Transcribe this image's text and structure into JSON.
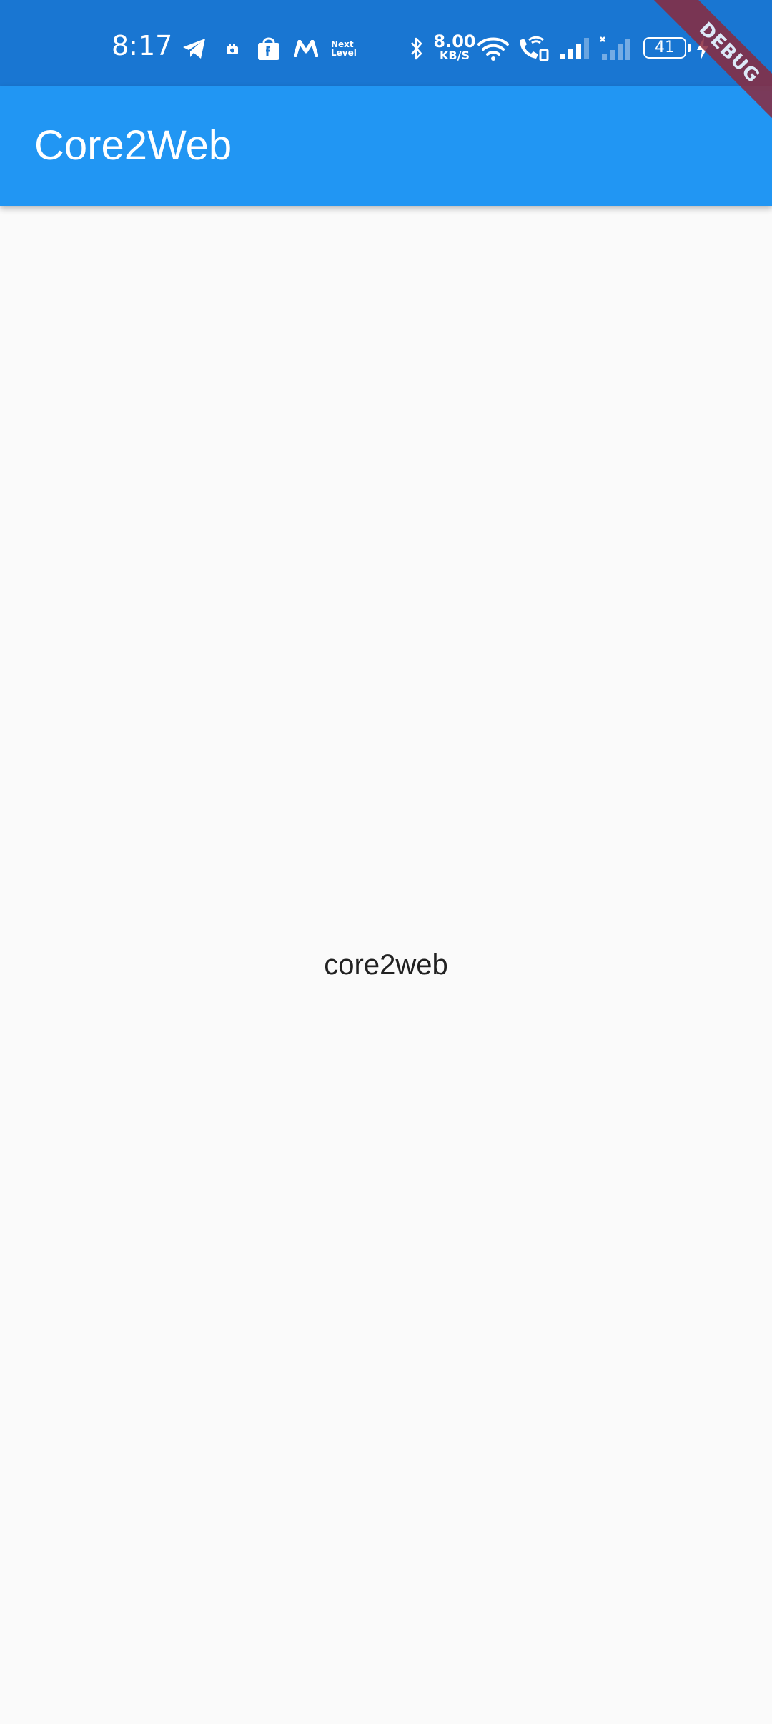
{
  "status_bar": {
    "time": "8:17",
    "notification_icons": [
      "telegram-icon",
      "camera-recorder-icon",
      "shopping-bag-icon",
      "myntra-icon"
    ],
    "next_level_text": "Next\nLevel",
    "network_speed_value": "8.00",
    "network_speed_unit": "KB/S",
    "system_icons": [
      "bluetooth-icon",
      "wifi-icon",
      "wifi-calling-icon",
      "signal-icon",
      "no-signal-icon"
    ],
    "battery_level": "41",
    "charging": true,
    "background_color": "#1976d2"
  },
  "app_bar": {
    "title": "Core2Web",
    "background_color": "#2196f3"
  },
  "body": {
    "center_text": "core2web",
    "background_color": "#fafafa"
  },
  "debug_banner": {
    "label": "DEBUG",
    "color": "#8a2a3e"
  }
}
